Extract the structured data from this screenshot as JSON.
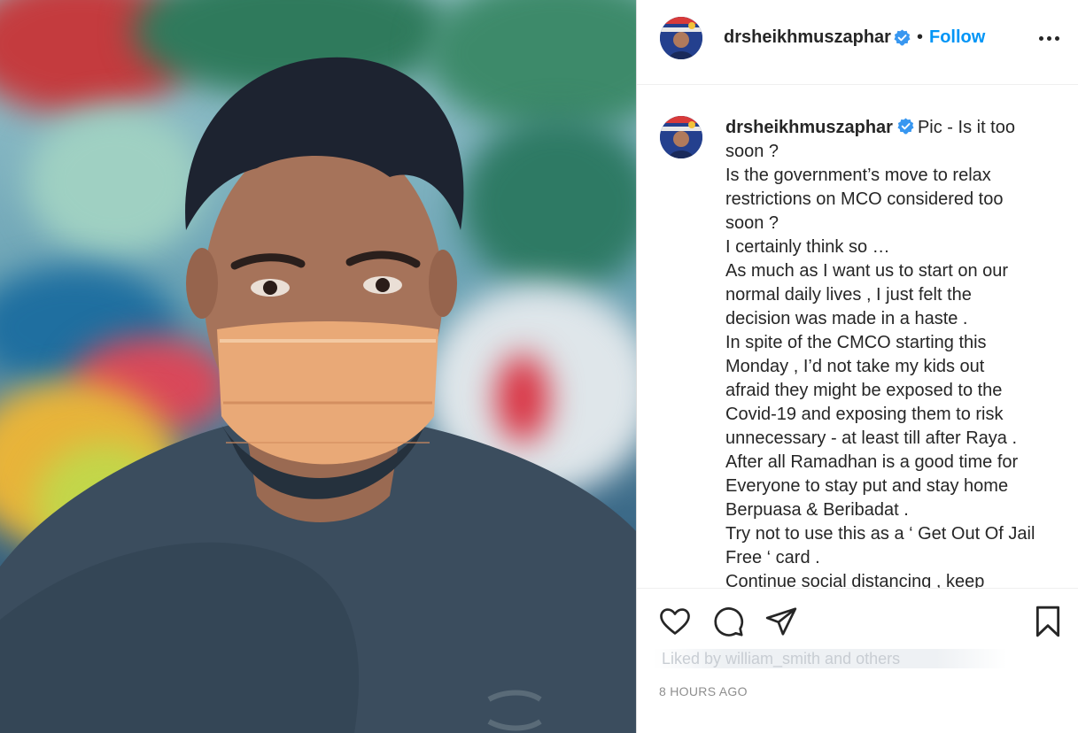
{
  "post": {
    "username": "drsheikhmuszaphar",
    "follow_label": "Follow",
    "separator": "•",
    "caption_first": "Pic - Is it too",
    "caption_lines": [
      "soon ?",
      "Is the government’s move to relax",
      "restrictions on MCO considered too",
      "soon ?",
      "I certainly think so …",
      "As much as I want us to start on our",
      "normal daily lives , I just felt the",
      "decision was made in a haste .",
      "In spite of the CMCO starting this",
      "Monday , I’d not take my kids out",
      "afraid they might be exposed to the",
      "Covid-19 and exposing them to risk",
      "unnecessary - at least till after Raya .",
      "After all Ramadhan is a good time for",
      "Everyone to stay put and stay home",
      "Berpuasa & Beribadat .",
      "Try not to use this as a ‘ Get Out Of Jail",
      "Free ‘ card .",
      "Continue social distancing , keep"
    ],
    "likes_text": "Liked by william_smith and others",
    "time_ago": "8 HOURS AGO"
  },
  "icons": {
    "verified": "verified-badge-icon",
    "more": "more-options-icon",
    "like": "heart-icon",
    "comment": "comment-icon",
    "share": "paper-plane-icon",
    "save": "bookmark-icon"
  },
  "colors": {
    "follow": "#0095f6",
    "verified": "#3897f0",
    "text": "#262626",
    "muted": "#8e8e8e"
  }
}
